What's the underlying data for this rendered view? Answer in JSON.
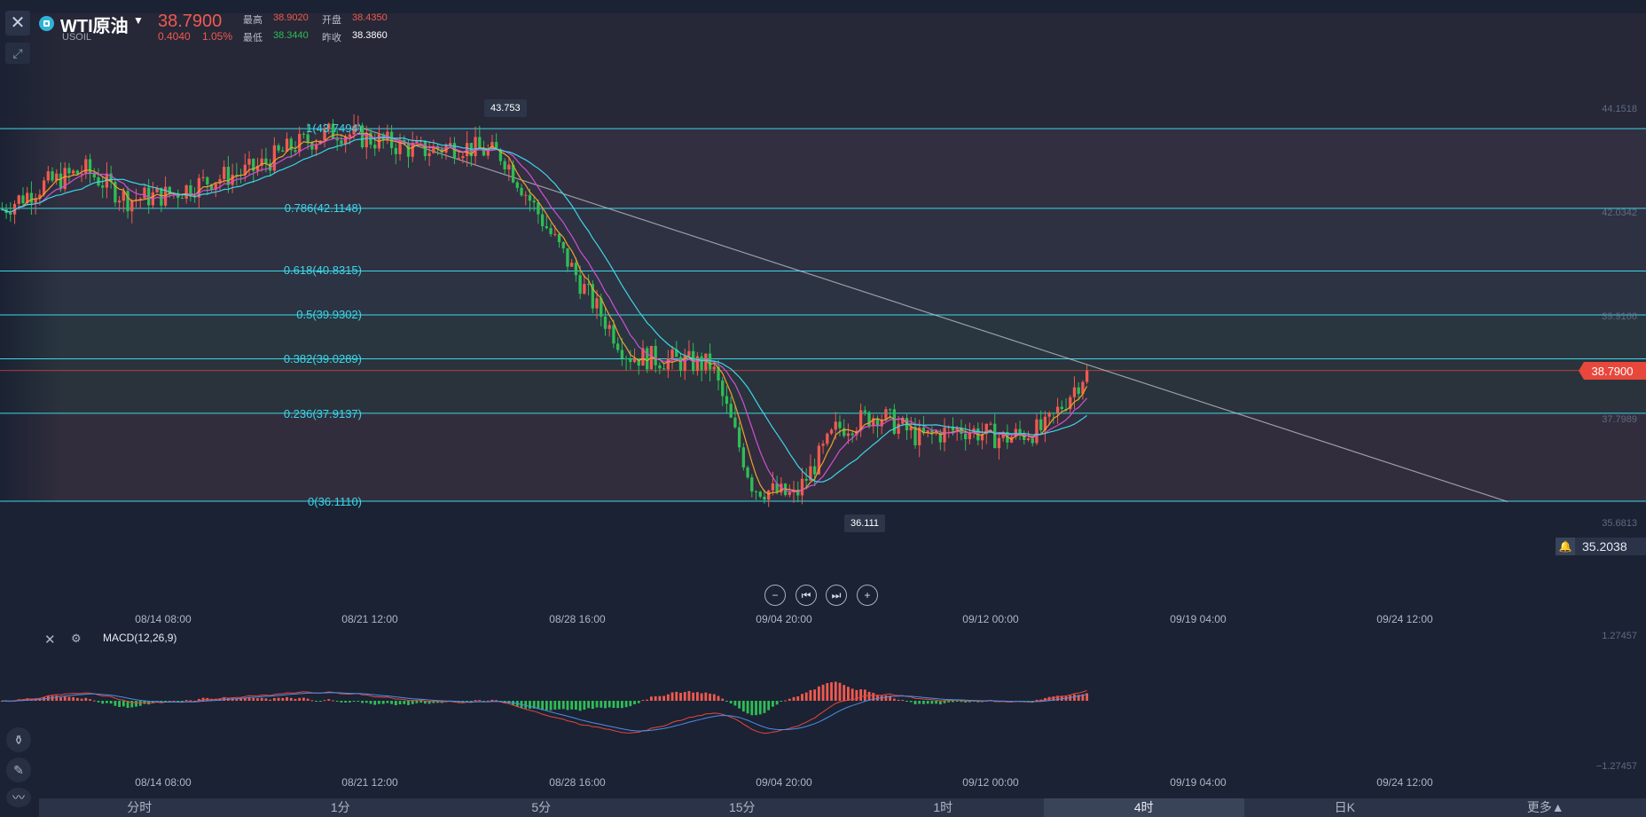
{
  "header": {
    "close_icon": "close-icon",
    "tool_icon": "measure-icon",
    "symbol_name": "WTI原油",
    "symbol_code": "USOIL",
    "caret": "▼",
    "last_price": "38.7900",
    "change": "0.4040",
    "change_pct": "1.05%",
    "high_label": "最高",
    "high_value": "38.9020",
    "low_label": "最低",
    "low_value": "38.3440",
    "open_label": "开盘",
    "open_value": "38.4350",
    "prev_close_label": "昨收",
    "prev_close_value": "38.3860"
  },
  "colors": {
    "up": "#f05a4f",
    "down": "#2ebd55",
    "fib_line": "#3bd7e8",
    "ma5": "#f0a030",
    "ma10": "#d14fd6",
    "ma20": "#3bd7e8",
    "background": "#1b2233"
  },
  "fib_levels": [
    {
      "label": "1(43.7494)",
      "price": 43.7494
    },
    {
      "label": "0.786(42.1148)",
      "price": 42.1148
    },
    {
      "label": "0.618(40.8315)",
      "price": 40.8315
    },
    {
      "label": "0.5(39.9302)",
      "price": 39.9302
    },
    {
      "label": "0.382(39.0289)",
      "price": 39.0289
    },
    {
      "label": "0.236(37.9137)",
      "price": 37.9137
    },
    {
      "label": "0(36.1110)",
      "price": 36.111
    }
  ],
  "price_axis": [
    "44.1518",
    "42.0342",
    "39.9166",
    "37.7989",
    "35.6813"
  ],
  "current_price_tag": "38.7900",
  "alert": {
    "icon": "bell-icon",
    "value": "35.2038"
  },
  "callouts": {
    "high": "43.753",
    "low": "36.111"
  },
  "nav_buttons": [
    {
      "icon": "zoom-out-icon",
      "glyph": "−"
    },
    {
      "icon": "skip-back-icon",
      "glyph": "⏮"
    },
    {
      "icon": "skip-forward-icon",
      "glyph": "⏭"
    },
    {
      "icon": "zoom-in-icon",
      "glyph": "+"
    }
  ],
  "time_axis": [
    "08/14 08:00",
    "08/21 12:00",
    "08/28 16:00",
    "09/04 20:00",
    "09/12 00:00",
    "09/19 04:00",
    "09/24 12:00"
  ],
  "macd": {
    "label": "MACD(12,26,9)",
    "axis_top": "1.27457",
    "axis_bottom": "−1.27457"
  },
  "left_tools": [
    {
      "icon": "indicator-icon",
      "glyph": "⚱"
    },
    {
      "icon": "pencil-icon",
      "glyph": "✎"
    },
    {
      "icon": "line-chart-icon",
      "glyph": "〰"
    }
  ],
  "timeframes": [
    "分时",
    "1分",
    "5分",
    "15分",
    "1时",
    "4时",
    "日K",
    "更多▲"
  ],
  "active_timeframe": 5,
  "chart_data": {
    "type": "candlestick",
    "title": "WTI原油 USOIL",
    "interval": "4时",
    "x": [
      "08/14 08:00",
      "08/21 12:00",
      "08/28 16:00",
      "09/04 20:00",
      "09/12 00:00",
      "09/19 04:00",
      "09/24 12:00"
    ],
    "ylim": [
      35.2,
      44.5
    ],
    "series": [
      {
        "name": "price_path",
        "values": [
          42.1,
          42.6,
          42.9,
          42.3,
          42.4,
          42.7,
          42.9,
          43.4,
          43.7,
          43.5,
          43.3,
          43.4,
          43.2,
          41.8,
          40.4,
          39.1,
          39.0,
          38.9,
          36.4,
          36.2,
          37.6,
          37.9,
          37.4,
          37.6,
          37.4,
          37.6,
          38.8
        ]
      }
    ],
    "trend_line": {
      "from": [
        "08/14 08:00",
        43.75
      ],
      "to": [
        "09/24 12:00",
        36.1
      ]
    },
    "macd_range": [
      -1.27457,
      1.27457
    ]
  }
}
